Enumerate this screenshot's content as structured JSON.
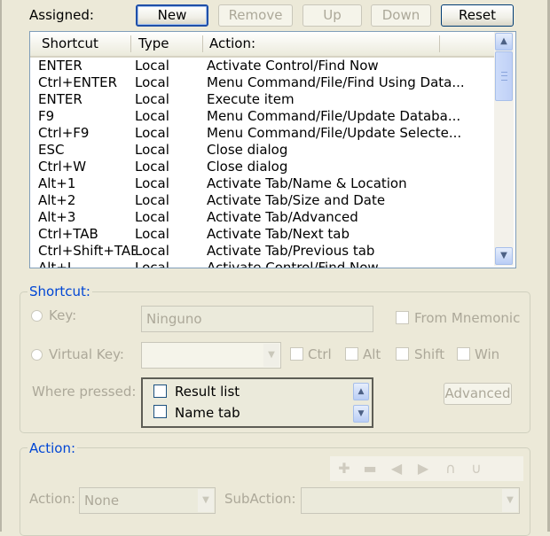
{
  "assigned": {
    "label": "Assigned:",
    "buttons": {
      "new": "New",
      "remove": "Remove",
      "up": "Up",
      "down": "Down",
      "reset": "Reset"
    }
  },
  "list": {
    "columns": {
      "shortcut": "Shortcut",
      "type": "Type",
      "action": "Action:"
    },
    "rows": [
      {
        "shortcut": "ENTER",
        "type": "Local",
        "action": "Activate Control/Find Now"
      },
      {
        "shortcut": "Ctrl+ENTER",
        "type": "Local",
        "action": "Menu Command/File/Find Using Data..."
      },
      {
        "shortcut": "ENTER",
        "type": "Local",
        "action": "Execute item"
      },
      {
        "shortcut": "F9",
        "type": "Local",
        "action": "Menu Command/File/Update Databa..."
      },
      {
        "shortcut": "Ctrl+F9",
        "type": "Local",
        "action": "Menu Command/File/Update Selecte..."
      },
      {
        "shortcut": "ESC",
        "type": "Local",
        "action": "Close dialog"
      },
      {
        "shortcut": "Ctrl+W",
        "type": "Local",
        "action": "Close dialog"
      },
      {
        "shortcut": "Alt+1",
        "type": "Local",
        "action": "Activate Tab/Name & Location"
      },
      {
        "shortcut": "Alt+2",
        "type": "Local",
        "action": "Activate Tab/Size and Date"
      },
      {
        "shortcut": "Alt+3",
        "type": "Local",
        "action": "Activate Tab/Advanced"
      },
      {
        "shortcut": "Ctrl+TAB",
        "type": "Local",
        "action": "Activate Tab/Next tab"
      },
      {
        "shortcut": "Ctrl+Shift+TAB",
        "type": "Local",
        "action": "Activate Tab/Previous tab"
      },
      {
        "shortcut": "Alt+L",
        "type": "Local",
        "action": "Activate Control/Find Now"
      }
    ]
  },
  "shortcut_group": {
    "legend": "Shortcut:",
    "key_label": "Key:",
    "key_value": "Ninguno",
    "from_mnemonic": "From Mnemonic",
    "virtual_key_label": "Virtual Key:",
    "ctrl": "Ctrl",
    "alt": "Alt",
    "shift": "Shift",
    "win": "Win",
    "where_pressed": "Where pressed:",
    "where_items": [
      "Result list",
      "Name tab"
    ],
    "advanced": "Advanced"
  },
  "action_group": {
    "legend": "Action:",
    "action_label": "Action:",
    "action_value": "None",
    "subaction_label": "SubAction:",
    "subaction_value": "",
    "tools": [
      "plus-icon",
      "minus-icon",
      "arrow-left-icon",
      "arrow-right-icon",
      "undo-icon",
      "redo-icon"
    ]
  }
}
